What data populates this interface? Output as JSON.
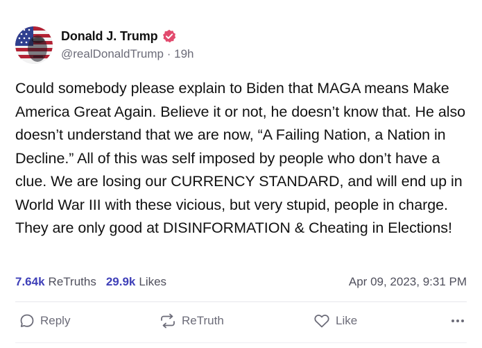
{
  "author": {
    "name": "Donald J. Trump",
    "handle": "@realDonaldTrump",
    "separator": "·",
    "time_ago": "19h",
    "avatar_icon": "flag-portrait-avatar",
    "verified_icon": "verified-badge-icon"
  },
  "post": {
    "text": "Could somebody please explain to Biden that MAGA means Make America Great Again. Believe it or not, he doesn’t know that. He also doesn’t understand that we are now, “A Failing Nation, a Nation in Decline.” All of this was self imposed by people who don’t have a clue. We are losing our CURRENCY STANDARD, and will end up in World War III with these vicious, but very stupid, people in charge. They are only good at DISINFORMATION & Cheating in Elections!"
  },
  "stats": {
    "retruths_count": "7.64k",
    "retruths_label": "ReTruths",
    "likes_count": "29.9k",
    "likes_label": "Likes",
    "timestamp": "Apr 09, 2023, 9:31 PM"
  },
  "actions": {
    "reply_label": "Reply",
    "retruth_label": "ReTruth",
    "like_label": "Like"
  },
  "colors": {
    "accent": "#3e3fb8",
    "verified": "#e24b6e",
    "muted": "#6b6b78"
  }
}
